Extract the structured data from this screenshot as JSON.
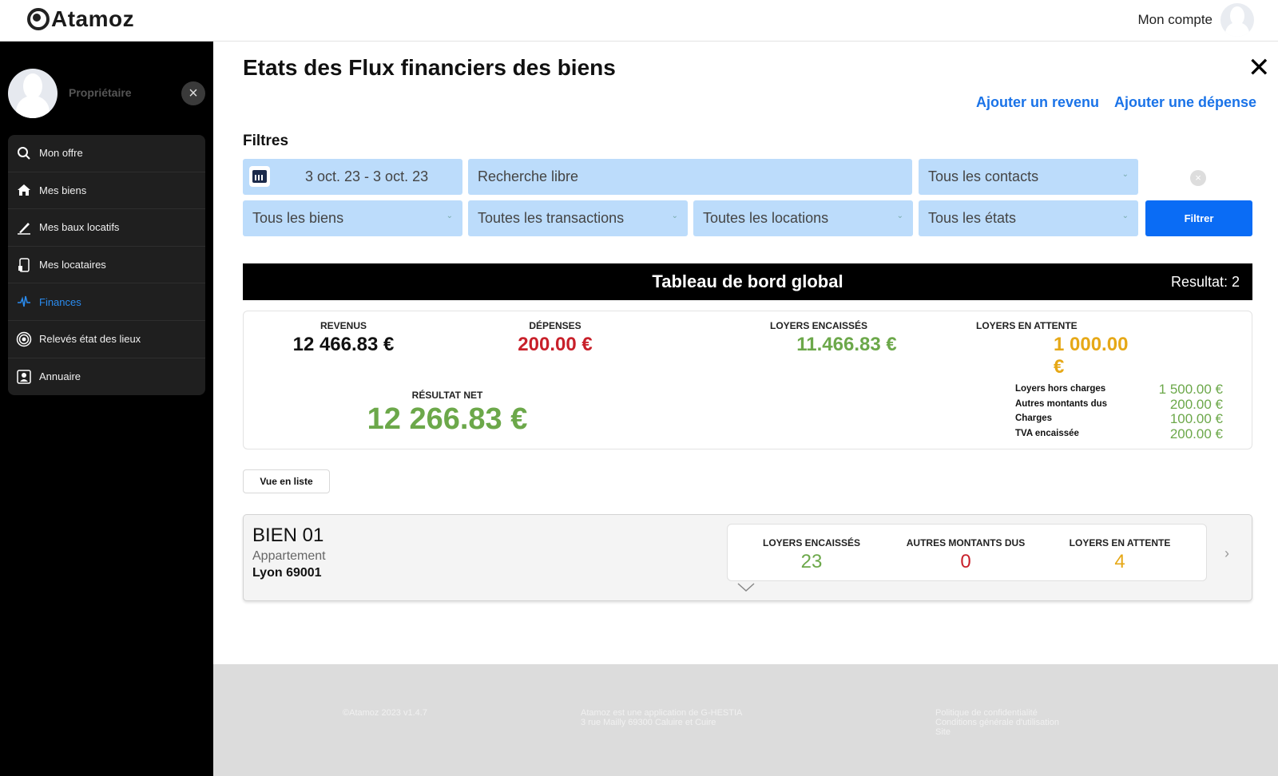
{
  "app": {
    "logo_text": "Atamoz"
  },
  "header": {
    "account_label": "Mon compte"
  },
  "sidebar": {
    "role": "Propriétaire",
    "items": [
      {
        "label": "Mon offre",
        "icon": "search-icon"
      },
      {
        "label": "Mes biens",
        "icon": "home-icon"
      },
      {
        "label": "Mes baux locatifs",
        "icon": "pen-icon"
      },
      {
        "label": "Mes locataires",
        "icon": "tenant-icon"
      },
      {
        "label": "Finances",
        "icon": "pulse-icon",
        "active": true
      },
      {
        "label": "Relevés état des lieux",
        "icon": "target-icon"
      },
      {
        "label": "Annuaire",
        "icon": "contacts-icon"
      }
    ]
  },
  "page": {
    "title": "Etats des Flux financiers des biens",
    "add_income": "Ajouter un revenu",
    "add_expense": "Ajouter une dépense"
  },
  "filters": {
    "label": "Filtres",
    "date_range": "3 oct. 23 - 3 oct. 23",
    "search_placeholder": "Recherche libre",
    "contacts": "Tous les contacts",
    "properties": "Tous les biens",
    "transactions": "Toutes les transactions",
    "rentals": "Toutes les locations",
    "states": "Tous les états",
    "filter_button": "Filtrer"
  },
  "dashboard": {
    "title": "Tableau de bord global",
    "result": "Resultat: 2",
    "revenus_label": "REVENUS",
    "revenus_value": "12 466.83 €",
    "depenses_label": "DÉPENSES",
    "depenses_value": "200.00 €",
    "loyers_encaisses_label": "LOYERS ENCAISSÉS",
    "loyers_encaisses_value": "11.466.83 €",
    "loyers_attente_label": "LOYERS EN ATTENTE",
    "loyers_attente_value": "1 000.00 €",
    "net_label": "RÉSULTAT NET",
    "net_value": "12 266.83 €",
    "breakdown": [
      {
        "label": "Loyers hors charges",
        "value": "1 500.00 €"
      },
      {
        "label": "Autres montants dus",
        "value": "200.00 €"
      },
      {
        "label": "Charges",
        "value": "100.00 €"
      },
      {
        "label": "TVA encaissée",
        "value": "200.00 €"
      }
    ]
  },
  "view_list_button": "Vue en liste",
  "property": {
    "name": "BIEN 01",
    "type": "Appartement",
    "city": "Lyon 69001",
    "loyers_encaisses_label": "LOYERS ENCAISSÉS",
    "loyers_encaisses_value": "23",
    "autres_label": "AUTRES MONTANTS DUS",
    "autres_value": "0",
    "attente_label": "LOYERS EN ATTENTE",
    "attente_value": "4"
  },
  "footer": {
    "copyright": "©Atamoz 2023 v1.4.7",
    "company_line1": "Atamoz est une application de G-HESTIA",
    "company_line2": "3 rue Mailly 69300 Caluire et Cuire",
    "privacy": "Politique de confidentialité",
    "terms": "Conditions générale d'utilisation",
    "site": "Site"
  },
  "colors": {
    "green": "#6ca84a",
    "red": "#c8202a",
    "amber": "#e6a817",
    "link_blue": "#1a73e8",
    "filter_bg": "#bcdcfb",
    "button_blue": "#0a6cf5"
  }
}
